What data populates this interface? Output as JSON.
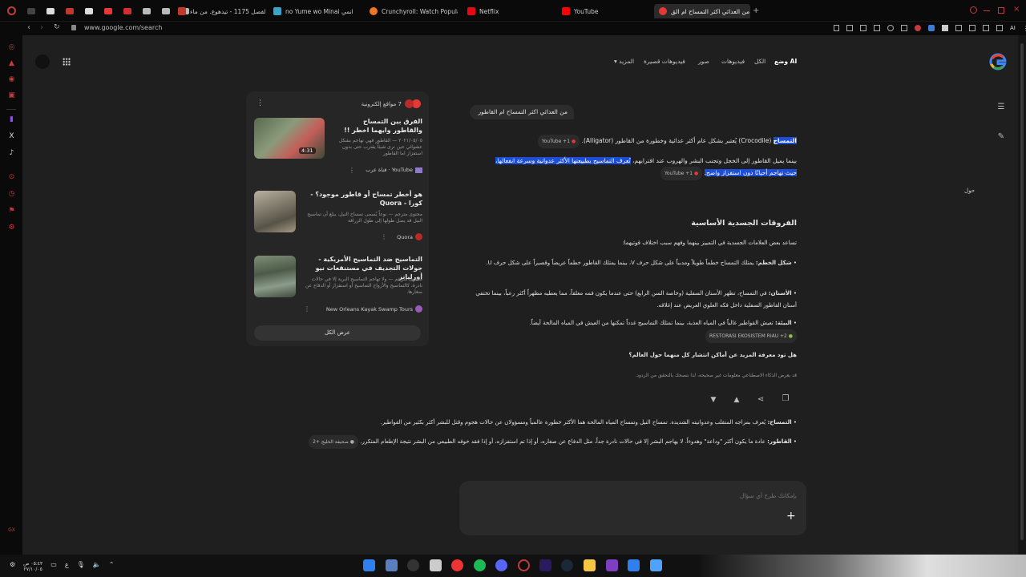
{
  "tabs": [
    {
      "label": "",
      "color": "#c0392b"
    },
    {
      "label": "الفصل 1175 - تيدهوع. من ماء",
      "color": "#c0392b"
    },
    {
      "label": "no Yume wo Minai انمي",
      "color": "#3ba3c9"
    },
    {
      "label": "Crunchyroll: Watch Popular",
      "color": "#f47521"
    },
    {
      "label": "Netflix",
      "color": "#e50914"
    },
    {
      "label": "YouTube",
      "color": "#ff0000"
    },
    {
      "label": "من العدائي اكثر التمساح ام الق",
      "color": "#e53935"
    }
  ],
  "address": {
    "url": "www.google.com/search"
  },
  "google_nav": {
    "ai_mode": "وضع AI",
    "all": "الكل",
    "videos": "فيديوهات",
    "images": "صور",
    "short_videos": "فيديوهات قصيرة",
    "more": "المزيد"
  },
  "query": "من العدائي اكثر التمساح ام القاطور",
  "answer": {
    "p1_start": "التمساح",
    "p1_rest": " (Crocodile) يُعتبر بشكل عام أكثر عدائية وخطورة من القاطور (Alligator).",
    "p1_chip": "YouTube +1",
    "p2_line1_plain": "بينما يميل القاطور إلى الخجل وتجنب البشر والهروب عند اقترابهم، ",
    "p2_line1_hl": "تُعرف التماسيح بطبيعتها الأكثر عدوانية وسرعة انفعالها،",
    "p2_line2_hl": "حيث تهاجم أحيانًا دون استفزاز واضح.",
    "p2_chip": "YouTube +1",
    "side_label": "حول",
    "section_title": "الفروقات الجسدية الأساسية",
    "section_intro": "تساعد بعض العلامات الجسدية في التمييز بينهما وفهم سبب اختلاف قوتيهما:",
    "b1_title": "شكل الخطم:",
    "b1_text": " يمتلك التمساح خطماً طويلاً ومدبباً على شكل حرف V، بينما يمتلك القاطور خطماً عريضاً وقصيراً على شكل حرف U.",
    "b2_title": "الأسنان:",
    "b2_text": " في التمساح، تظهر الأسنان السفلية (وخاصة السن الرابع) حتى عندما يكون فمه مغلقاً، مما يعطيه مظهراً أكثر رعباً، بينما تختفي أسنان القاطور السفلية داخل فكه العلوي العريض عند إغلاقه.",
    "b3_title": "البيئة:",
    "b3_text": " تعيش القواطير غالباً في المياه العذبة، بينما تمتلك التماسيح غدداً تمكنها من العيش في المياه المالحة أيضاً.",
    "b3_chip": "RESTORASI EKOSISTEM RIAU +2",
    "followup_q": "هل تود معرفة المزيد عن أماكن انتشار كل منهما حول العالم؟",
    "disclaimer": "قد يعرض الذكاء الاصطناعي معلومات غير صحيحة، لذا ننصحك بالتحقق من الردود.",
    "lower_b1_title": "التمساح:",
    "lower_b1_text": " يُعرف بمزاجه المتقلب وعدوانيته الشديدة. تمساح النيل وتمساح المياه المالحة هما الأكثر خطورة عالمياً ومسؤولان عن حالات هجوم وقتل للبشر أكثر بكثير من القواطير.",
    "lower_b2_title": "القاطور:",
    "lower_b2_text": " عادة ما يكون أكثر \"وداعة\" وهدوءاً. لا يهاجم البشر إلا في حالات نادرة جداً، مثل الدفاع عن صغاره، أو إذا تم استفزازه، أو إذا فقد خوفه الطبيعي من البشر نتيجة الإطعام المتكرر.",
    "lower_b2_chip": "صحيفة الخليج +2"
  },
  "sources": {
    "count_label": "7 مواقع إلكترونية",
    "cards": [
      {
        "title": "الفرق بين التمساح والقاطور وايهما اخطر !!",
        "snippet": "٢٠٢١/٠٥/٠٥ — القاطور فهي تهاجم بشكل عشوائي حين ترى شيئاً يقترب حتى بدون استفزاز اما القاطور",
        "source": "YouTube · قناة عرب",
        "duration": "4:31"
      },
      {
        "title": "هو أخطر تمساح أو قاطور موجود؟ - كورا - Quora",
        "snippet": "محتوى مترجم — نوعاً يُسمى تمساح النيل، يبلغ أن تماسيح النيل قد يصل طولها إلى طول الزرافة",
        "source": "Quora",
        "duration": ""
      },
      {
        "title": "التماسيح ضد التماسيح الأمريكية - جولات التجديف في مستنقعات نيو أورليانز",
        "snippet": "محتوى مترجم — ولا تهاجم التماسيح البرية إلا في حالات نادرة، كالتماسيح والأزواج التماسيح أو استفزاز أو الدفاع عن صغارها.",
        "source": "New Orleans Kayak Swamp Tours",
        "duration": ""
      }
    ],
    "show_all": "عرض الكل"
  },
  "composer": {
    "placeholder": "بإمكانك طرح أي سؤال"
  },
  "clock": {
    "time": "٠٥:٤٣ ص",
    "date": "٢٧/١٠/٠٥"
  },
  "colors": {
    "accent": "#1d4ed8",
    "page_bg": "#1f1f1f",
    "opera_red": "#c53a3a"
  },
  "icons": [
    "google-logo",
    "apps-grid-icon",
    "new-chat-icon",
    "list-icon",
    "thumb-down-icon",
    "thumb-up-icon",
    "share-icon",
    "copy-icon",
    "plus-icon"
  ]
}
